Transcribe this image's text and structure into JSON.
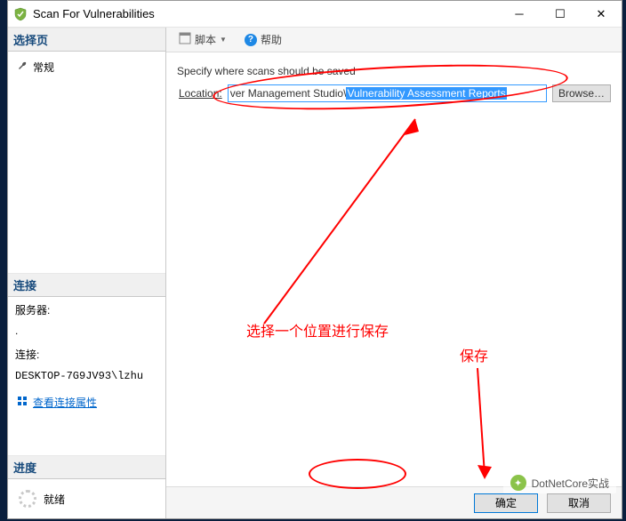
{
  "window": {
    "title": "Scan For Vulnerabilities"
  },
  "sidebar": {
    "selectPage": {
      "header": "选择页",
      "general": "常规"
    },
    "connection": {
      "header": "连接",
      "server_label": "服务器:",
      "server_value": ".",
      "conn_label": "连接:",
      "conn_value": "DESKTOP-7G9JV93\\lzhu",
      "view_props": "查看连接属性"
    },
    "progress": {
      "header": "进度",
      "status": "就绪"
    }
  },
  "toolbar": {
    "script": "脚本",
    "help": "帮助"
  },
  "content": {
    "instruction": "Specify where scans should be saved",
    "location_label": "Location:",
    "path_prefix": "ver Management Studio\\",
    "path_selected": "Vulnerability Assessment Reports",
    "browse": "Browse…"
  },
  "buttons": {
    "ok": "确定",
    "cancel": "取消"
  },
  "annotations": {
    "main_note": "选择一个位置进行保存",
    "save_note": "保存"
  },
  "watermark": {
    "text": "DotNetCore实战"
  }
}
